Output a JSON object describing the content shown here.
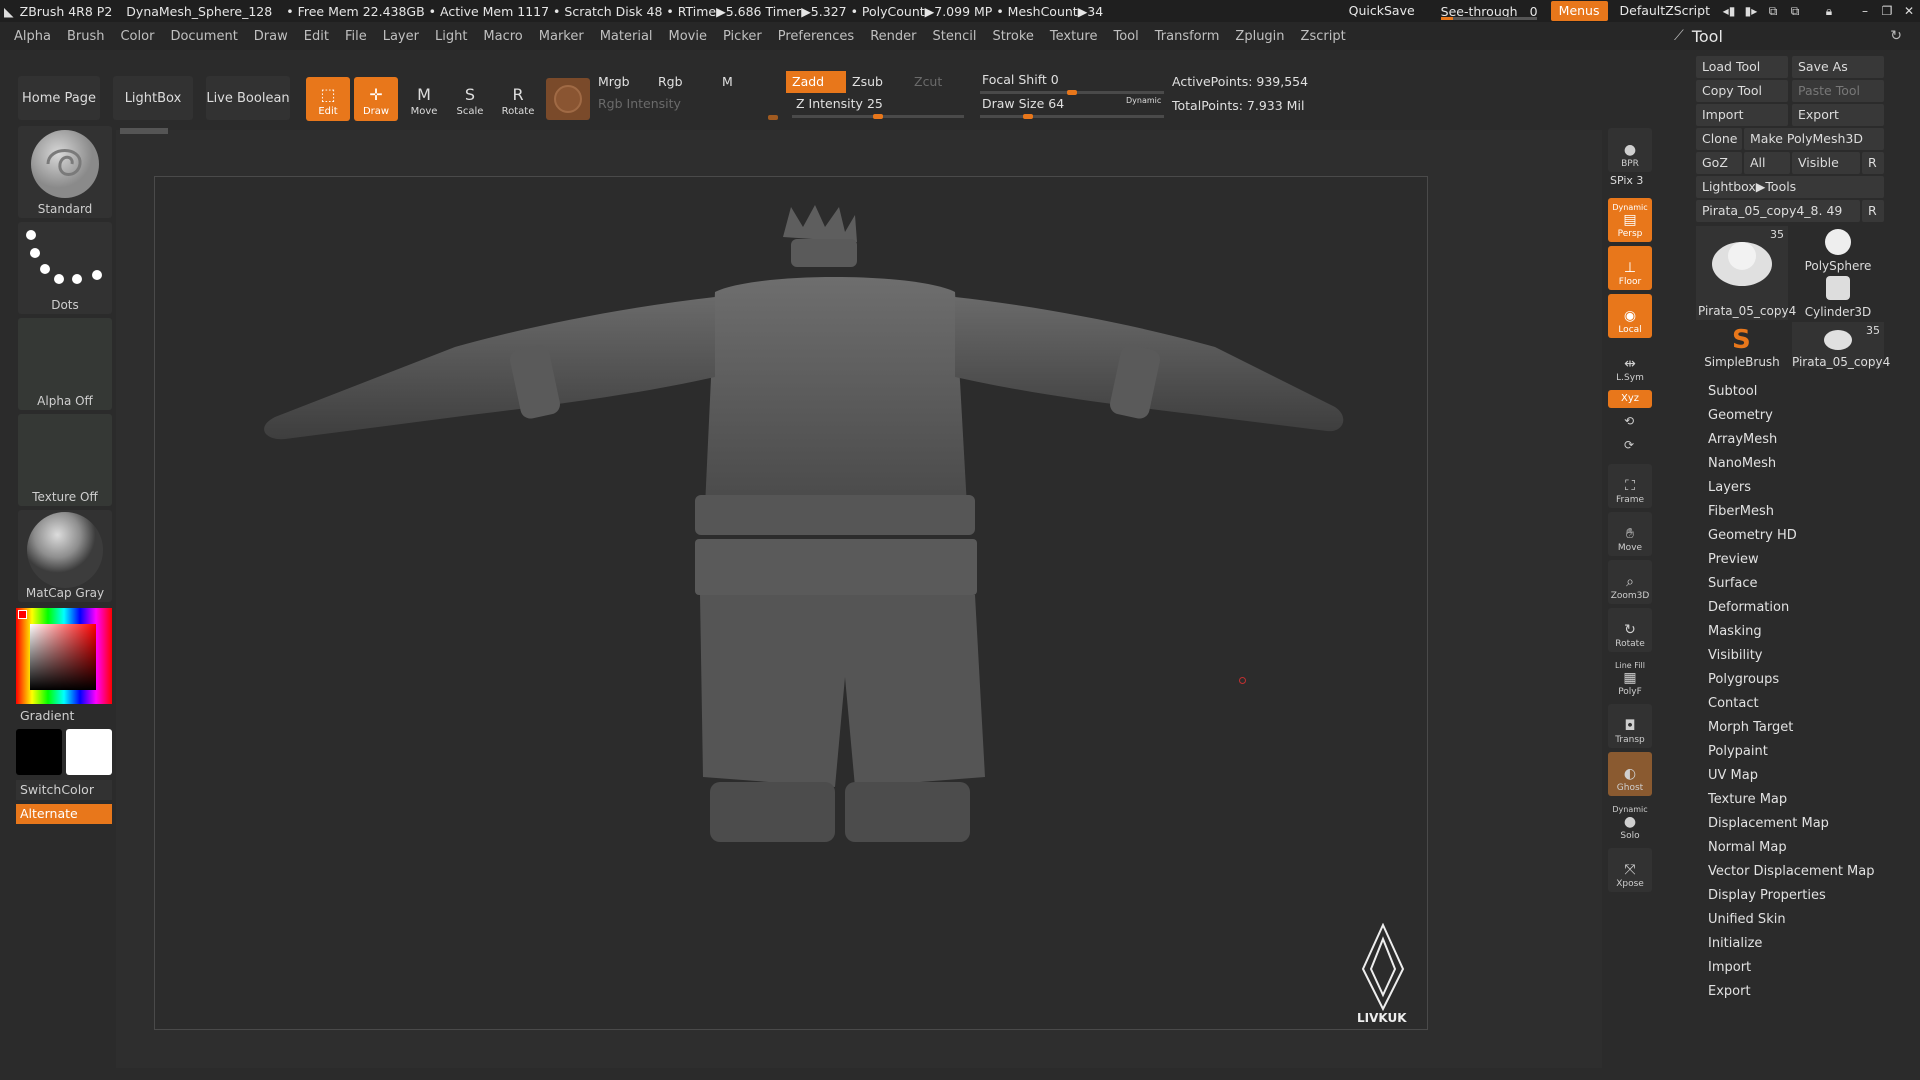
{
  "titlebar": {
    "app": "ZBrush 4R8 P2",
    "file": "DynaMesh_Sphere_128",
    "stats": "• Free Mem 22.438GB • Active Mem 1117 • Scratch Disk 48 • RTime▶5.686 Timer▶5.327 • PolyCount▶7.099 MP • MeshCount▶34",
    "quicksave": "QuickSave",
    "see_through_label": "See-through",
    "see_through_value": "0",
    "menus": "Menus",
    "script": "DefaultZScript"
  },
  "menu": [
    "Alpha",
    "Brush",
    "Color",
    "Document",
    "Draw",
    "Edit",
    "File",
    "Layer",
    "Light",
    "Macro",
    "Marker",
    "Material",
    "Movie",
    "Picker",
    "Preferences",
    "Render",
    "Stencil",
    "Stroke",
    "Texture",
    "Tool",
    "Transform",
    "Zplugin",
    "Zscript"
  ],
  "shelf": {
    "home": "Home Page",
    "lightbox": "LightBox",
    "live_boolean": "Live Boolean",
    "edit": "Edit",
    "draw": "Draw",
    "move": "Move",
    "scale": "Scale",
    "rotate": "Rotate",
    "mrgb": "Mrgb",
    "rgb": "Rgb",
    "m": "M",
    "rgb_intensity": "Rgb Intensity",
    "zadd": "Zadd",
    "zsub": "Zsub",
    "zcut": "Zcut",
    "z_intensity_label": "Z Intensity",
    "z_intensity": "25",
    "focal_shift_label": "Focal Shift",
    "focal_shift": "0",
    "draw_size_label": "Draw Size",
    "draw_size": "64",
    "dynamic": "Dynamic",
    "active_points": "ActivePoints: 939,554",
    "total_points": "TotalPoints: 7.933 Mil"
  },
  "left_tray": {
    "standard": "Standard",
    "dots": "Dots",
    "alpha_off": "Alpha Off",
    "texture_off": "Texture Off",
    "matcap": "MatCap Gray",
    "gradient": "Gradient",
    "switchcolor": "SwitchColor",
    "alternate": "Alternate"
  },
  "right_shelf": {
    "bpr": "BPR",
    "spix": "SPix 3",
    "dynamic": "Dynamic",
    "persp": "Persp",
    "floor": "Floor",
    "local": "Local",
    "lsym": "L.Sym",
    "xyz": "Xyz",
    "frame": "Frame",
    "move": "Move",
    "zoom3d": "Zoom3D",
    "rotate": "Rotate",
    "linefill": "Line Fill",
    "polyf": "PolyF",
    "transp": "Transp",
    "ghost": "Ghost",
    "dynamic2": "Dynamic",
    "solo": "Solo",
    "xpose": "Xpose"
  },
  "tool": {
    "title": "Tool",
    "load_tool": "Load Tool",
    "save_as": "Save As",
    "copy_tool": "Copy Tool",
    "paste_tool": "Paste Tool",
    "import": "Import",
    "export": "Export",
    "clone": "Clone",
    "make_polymesh": "Make PolyMesh3D",
    "goz": "GoZ",
    "all": "All",
    "visible": "Visible",
    "r": "R",
    "lightbox_tools": "Lightbox▶Tools",
    "current_tool": "Pirata_05_copy4_8. 49",
    "thumbs": [
      {
        "label": "Pirata_05_copy4",
        "count": "35"
      },
      {
        "label": "PolySphere",
        "count": ""
      },
      {
        "label": "Cylinder3D",
        "count": ""
      },
      {
        "label": "SimpleBrush",
        "count": ""
      },
      {
        "label": "Pirata_05_copy4",
        "count": "35"
      }
    ],
    "sections": [
      "Subtool",
      "Geometry",
      "ArrayMesh",
      "NanoMesh",
      "Layers",
      "FiberMesh",
      "Geometry HD",
      "Preview",
      "Surface",
      "Deformation",
      "Masking",
      "Visibility",
      "Polygroups",
      "Contact",
      "Morph Target",
      "Polypaint",
      "UV Map",
      "Texture Map",
      "Displacement Map",
      "Normal Map",
      "Vector Displacement Map",
      "Display Properties",
      "Unified Skin",
      "Initialize",
      "Import",
      "Export"
    ]
  },
  "watermark": "LIVKUK",
  "colors": {
    "accent": "#e8771b",
    "bg": "#2b2b2b",
    "panel": "#323232"
  }
}
